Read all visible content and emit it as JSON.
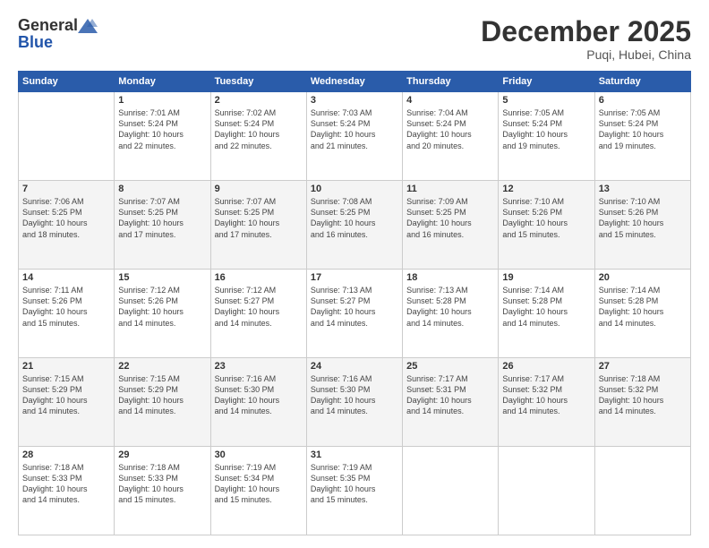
{
  "header": {
    "logo_general": "General",
    "logo_blue": "Blue",
    "month_title": "December 2025",
    "location": "Puqi, Hubei, China"
  },
  "days_of_week": [
    "Sunday",
    "Monday",
    "Tuesday",
    "Wednesday",
    "Thursday",
    "Friday",
    "Saturday"
  ],
  "weeks": [
    [
      {
        "day": "",
        "info": ""
      },
      {
        "day": "1",
        "info": "Sunrise: 7:01 AM\nSunset: 5:24 PM\nDaylight: 10 hours\nand 22 minutes."
      },
      {
        "day": "2",
        "info": "Sunrise: 7:02 AM\nSunset: 5:24 PM\nDaylight: 10 hours\nand 22 minutes."
      },
      {
        "day": "3",
        "info": "Sunrise: 7:03 AM\nSunset: 5:24 PM\nDaylight: 10 hours\nand 21 minutes."
      },
      {
        "day": "4",
        "info": "Sunrise: 7:04 AM\nSunset: 5:24 PM\nDaylight: 10 hours\nand 20 minutes."
      },
      {
        "day": "5",
        "info": "Sunrise: 7:05 AM\nSunset: 5:24 PM\nDaylight: 10 hours\nand 19 minutes."
      },
      {
        "day": "6",
        "info": "Sunrise: 7:05 AM\nSunset: 5:24 PM\nDaylight: 10 hours\nand 19 minutes."
      }
    ],
    [
      {
        "day": "7",
        "info": "Sunrise: 7:06 AM\nSunset: 5:25 PM\nDaylight: 10 hours\nand 18 minutes."
      },
      {
        "day": "8",
        "info": "Sunrise: 7:07 AM\nSunset: 5:25 PM\nDaylight: 10 hours\nand 17 minutes."
      },
      {
        "day": "9",
        "info": "Sunrise: 7:07 AM\nSunset: 5:25 PM\nDaylight: 10 hours\nand 17 minutes."
      },
      {
        "day": "10",
        "info": "Sunrise: 7:08 AM\nSunset: 5:25 PM\nDaylight: 10 hours\nand 16 minutes."
      },
      {
        "day": "11",
        "info": "Sunrise: 7:09 AM\nSunset: 5:25 PM\nDaylight: 10 hours\nand 16 minutes."
      },
      {
        "day": "12",
        "info": "Sunrise: 7:10 AM\nSunset: 5:26 PM\nDaylight: 10 hours\nand 15 minutes."
      },
      {
        "day": "13",
        "info": "Sunrise: 7:10 AM\nSunset: 5:26 PM\nDaylight: 10 hours\nand 15 minutes."
      }
    ],
    [
      {
        "day": "14",
        "info": "Sunrise: 7:11 AM\nSunset: 5:26 PM\nDaylight: 10 hours\nand 15 minutes."
      },
      {
        "day": "15",
        "info": "Sunrise: 7:12 AM\nSunset: 5:26 PM\nDaylight: 10 hours\nand 14 minutes."
      },
      {
        "day": "16",
        "info": "Sunrise: 7:12 AM\nSunset: 5:27 PM\nDaylight: 10 hours\nand 14 minutes."
      },
      {
        "day": "17",
        "info": "Sunrise: 7:13 AM\nSunset: 5:27 PM\nDaylight: 10 hours\nand 14 minutes."
      },
      {
        "day": "18",
        "info": "Sunrise: 7:13 AM\nSunset: 5:28 PM\nDaylight: 10 hours\nand 14 minutes."
      },
      {
        "day": "19",
        "info": "Sunrise: 7:14 AM\nSunset: 5:28 PM\nDaylight: 10 hours\nand 14 minutes."
      },
      {
        "day": "20",
        "info": "Sunrise: 7:14 AM\nSunset: 5:28 PM\nDaylight: 10 hours\nand 14 minutes."
      }
    ],
    [
      {
        "day": "21",
        "info": "Sunrise: 7:15 AM\nSunset: 5:29 PM\nDaylight: 10 hours\nand 14 minutes."
      },
      {
        "day": "22",
        "info": "Sunrise: 7:15 AM\nSunset: 5:29 PM\nDaylight: 10 hours\nand 14 minutes."
      },
      {
        "day": "23",
        "info": "Sunrise: 7:16 AM\nSunset: 5:30 PM\nDaylight: 10 hours\nand 14 minutes."
      },
      {
        "day": "24",
        "info": "Sunrise: 7:16 AM\nSunset: 5:30 PM\nDaylight: 10 hours\nand 14 minutes."
      },
      {
        "day": "25",
        "info": "Sunrise: 7:17 AM\nSunset: 5:31 PM\nDaylight: 10 hours\nand 14 minutes."
      },
      {
        "day": "26",
        "info": "Sunrise: 7:17 AM\nSunset: 5:32 PM\nDaylight: 10 hours\nand 14 minutes."
      },
      {
        "day": "27",
        "info": "Sunrise: 7:18 AM\nSunset: 5:32 PM\nDaylight: 10 hours\nand 14 minutes."
      }
    ],
    [
      {
        "day": "28",
        "info": "Sunrise: 7:18 AM\nSunset: 5:33 PM\nDaylight: 10 hours\nand 14 minutes."
      },
      {
        "day": "29",
        "info": "Sunrise: 7:18 AM\nSunset: 5:33 PM\nDaylight: 10 hours\nand 15 minutes."
      },
      {
        "day": "30",
        "info": "Sunrise: 7:19 AM\nSunset: 5:34 PM\nDaylight: 10 hours\nand 15 minutes."
      },
      {
        "day": "31",
        "info": "Sunrise: 7:19 AM\nSunset: 5:35 PM\nDaylight: 10 hours\nand 15 minutes."
      },
      {
        "day": "",
        "info": ""
      },
      {
        "day": "",
        "info": ""
      },
      {
        "day": "",
        "info": ""
      }
    ]
  ]
}
